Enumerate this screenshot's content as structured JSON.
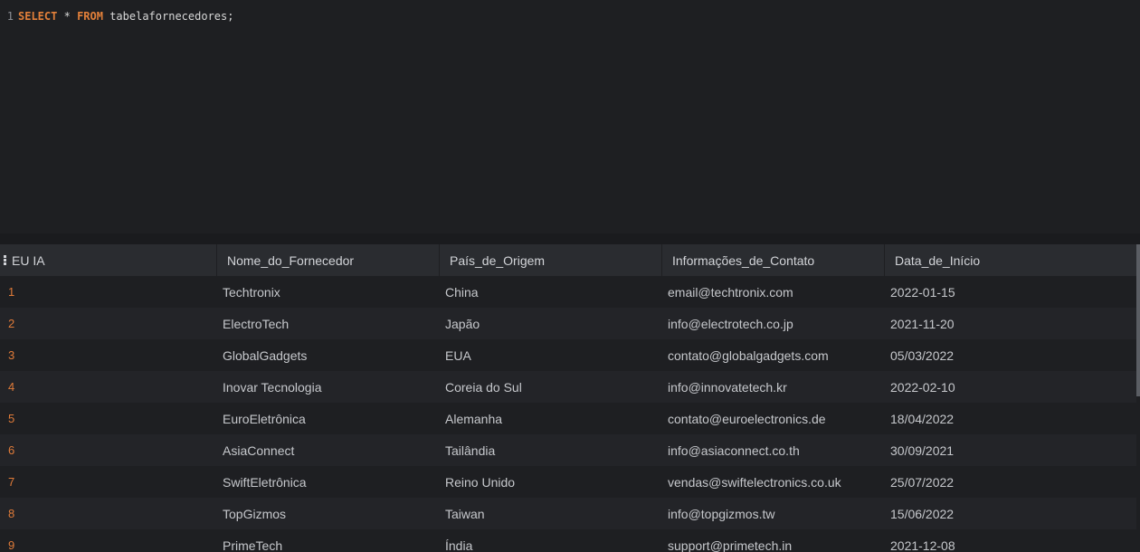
{
  "editor": {
    "line_number": "1",
    "kw_select": "SELECT",
    "star": "*",
    "kw_from": "FROM",
    "table": "tabelafornecedores;"
  },
  "grid": {
    "columns": [
      "EU IA",
      "Nome_do_Fornecedor",
      "País_de_Origem",
      "Informações_de_Contato",
      "Data_de_Início"
    ],
    "rows": [
      [
        "1",
        "Techtronix",
        "China",
        "email@techtronix.com",
        "2022-01-15"
      ],
      [
        "2",
        "ElectroTech",
        "Japão",
        "info@electrotech.co.jp",
        "2021-11-20"
      ],
      [
        "3",
        "GlobalGadgets",
        "EUA",
        "contato@globalgadgets.com",
        "05/03/2022"
      ],
      [
        "4",
        "Inovar Tecnologia",
        "Coreia do Sul",
        "info@innovatetech.kr",
        "2022-02-10"
      ],
      [
        "5",
        "EuroEletrônica",
        "Alemanha",
        "contato@euroelectronics.de",
        "18/04/2022"
      ],
      [
        "6",
        "AsiaConnect",
        "Tailândia",
        "info@asiaconnect.co.th",
        "30/09/2021"
      ],
      [
        "7",
        "SwiftEletrônica",
        "Reino Unido",
        "vendas@swiftelectronics.co.uk",
        "25/07/2022"
      ],
      [
        "8",
        "TopGizmos",
        "Taiwan",
        "info@topgizmos.tw",
        "15/06/2022"
      ],
      [
        "9",
        "PrimeTech",
        "Índia",
        "support@primetech.in",
        "2021-12-08"
      ]
    ]
  },
  "colors": {
    "keyword": "#e3803a",
    "row_id": "#e07b39",
    "background": "#1e1f22",
    "header_bg": "#2a2c30"
  }
}
